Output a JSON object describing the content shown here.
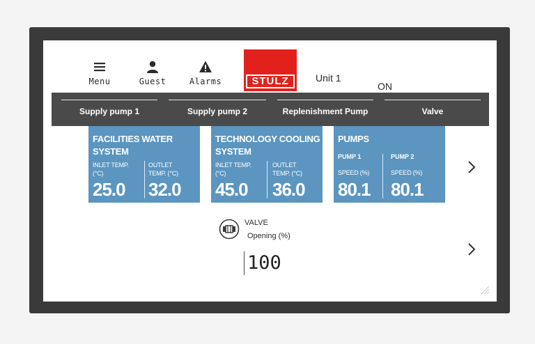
{
  "header": {
    "menu_label": "Menu",
    "user_label": "Guest",
    "alarms_label": "Alarms",
    "logo_text": "STULZ",
    "unit_label": "Unit 1",
    "status": "ON"
  },
  "tabs": [
    {
      "label": "Supply pump 1"
    },
    {
      "label": "Supply pump 2"
    },
    {
      "label": "Replenishment Pump"
    },
    {
      "label": "Valve"
    }
  ],
  "cards": {
    "facilities": {
      "title": "FACILITIES WATER SYSTEM",
      "inlet_label": "INLET TEMP. (°C)",
      "inlet_value": "25.0",
      "outlet_label": "OUTLET TEMP. (°C)",
      "outlet_value": "32.0"
    },
    "technology": {
      "title": "TECHNOLOGY COOLING SYSTEM",
      "inlet_label": "INLET TEMP. (°C)",
      "inlet_value": "45.0",
      "outlet_label": "OUTLET TEMP. (°C)",
      "outlet_value": "36.0"
    },
    "pumps": {
      "title": "PUMPS",
      "pump1_label": "PUMP 1",
      "pump1_speed_label": "SPEED (%)",
      "pump1_value": "80.1",
      "pump2_label": "PUMP 2",
      "pump2_speed_label": "SPEED (%)",
      "pump2_value": "80.1"
    }
  },
  "valve": {
    "label": "VALVE",
    "opening_label": "Opening (%)",
    "opening_value": "100"
  },
  "colors": {
    "card": "#5b95c0",
    "tabbar": "#4a4a4a",
    "logo": "#e3211c"
  }
}
